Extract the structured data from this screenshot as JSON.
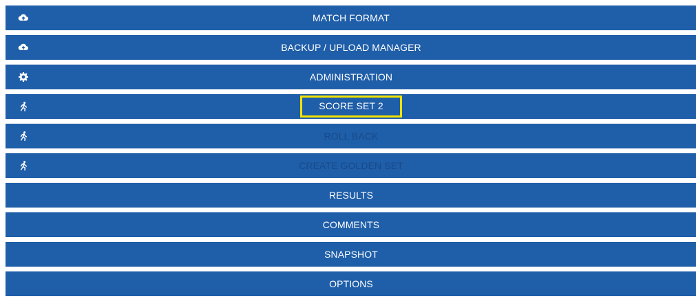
{
  "menu": {
    "items": [
      {
        "label": "MATCH FORMAT",
        "icon": "cloud-upload-icon"
      },
      {
        "label": "BACKUP / UPLOAD MANAGER",
        "icon": "cloud-upload-icon"
      },
      {
        "label": "ADMINISTRATION",
        "icon": "gear-icon"
      },
      {
        "label": "SCORE SET 2",
        "icon": "runner-icon",
        "highlighted": true
      },
      {
        "label": "ROLL BACK",
        "icon": "runner-icon",
        "disabled": true
      },
      {
        "label": "CREATE GOLDEN SET",
        "icon": "runner-icon",
        "disabled": true
      },
      {
        "label": "RESULTS"
      },
      {
        "label": "COMMENTS"
      },
      {
        "label": "SNAPSHOT"
      },
      {
        "label": "OPTIONS"
      }
    ]
  },
  "colors": {
    "row_background": "#1f5ea8",
    "text": "#ffffff",
    "disabled_text": "#17498a",
    "highlight_border": "#f3e300"
  }
}
